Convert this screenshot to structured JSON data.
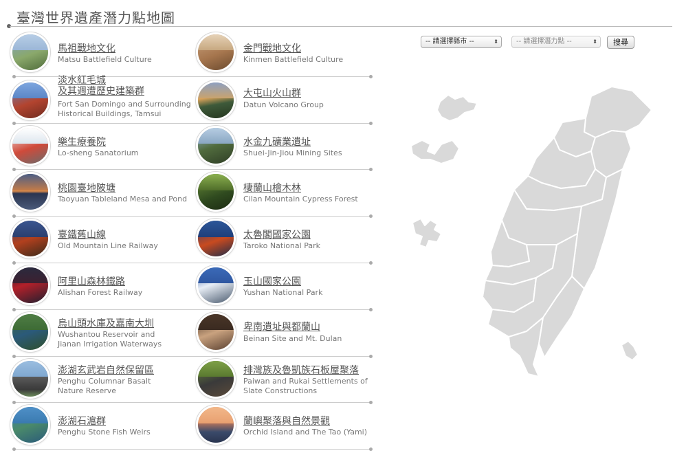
{
  "header": {
    "title": "臺灣世界遺產潛力點地圖"
  },
  "controls": {
    "county_select": "-- 請選擇縣市 --",
    "site_select": "-- 請選擇潛力點 --",
    "search_label": "搜尋"
  },
  "colors": {
    "map_fill": "#d9d9d9",
    "map_stroke": "#ffffff",
    "rule": "#cccccc"
  },
  "sites": [
    {
      "title": "馬祖戰地文化",
      "subtitle": "Matsu Battlefield Culture"
    },
    {
      "title": "金門戰地文化",
      "subtitle": "Kinmen Battlefield Culture"
    },
    {
      "title": "淡水紅毛城\n及其週遭歷史建築群",
      "title1": "淡水紅毛城",
      "title2": "及其週遭歷史建築群",
      "subtitle1": "Fort San Domingo and Surrounding",
      "subtitle2": "Historical Buildings, Tamsui"
    },
    {
      "title": "大屯山火山群",
      "subtitle": "Datun Volcano Group"
    },
    {
      "title": "樂生療養院",
      "subtitle": "Lo-sheng Sanatorium"
    },
    {
      "title": "水金九礦業遺址",
      "subtitle": "Shuei-Jin-Jiou Mining Sites"
    },
    {
      "title": "桃園臺地陂塘",
      "subtitle": "Taoyuan Tableland Mesa and Pond"
    },
    {
      "title": "棲蘭山檜木林",
      "subtitle": "Cilan Mountain Cypress Forest"
    },
    {
      "title": "臺鐵舊山線",
      "subtitle": "Old Mountain Line Railway"
    },
    {
      "title": "太魯閣國家公園",
      "subtitle": "Taroko National Park"
    },
    {
      "title": "阿里山森林鐵路",
      "subtitle": "Alishan Forest Railway"
    },
    {
      "title": "玉山國家公園",
      "subtitle": "Yushan National Park"
    },
    {
      "title": "烏山頭水庫及嘉南大圳",
      "subtitle1": "Wushantou Reservoir and",
      "subtitle2": "Jianan Irrigation Waterways"
    },
    {
      "title": "卑南遺址與都蘭山",
      "subtitle": "Beinan Site and Mt. Dulan"
    },
    {
      "title": "澎湖玄武岩自然保留區",
      "subtitle1": "Penghu Columnar Basalt",
      "subtitle2": "Nature Reserve"
    },
    {
      "title": "排灣族及魯凱族石板屋聚落",
      "subtitle1": "Paiwan and Rukai Settlements of",
      "subtitle2": "Slate Constructions"
    },
    {
      "title": "澎湖石滬群",
      "subtitle": "Penghu Stone Fish Weirs"
    },
    {
      "title": "蘭嶼聚落與自然景觀",
      "subtitle": "Orchid Island and The Tao (Yami)"
    }
  ]
}
